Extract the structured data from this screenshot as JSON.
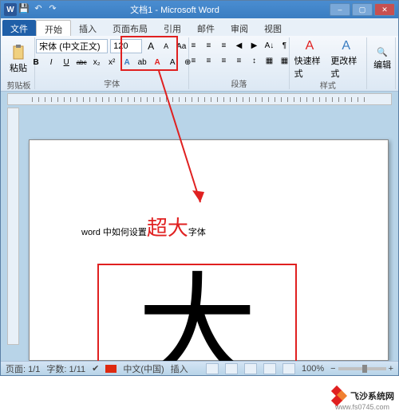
{
  "window": {
    "title": "文档1 - Microsoft Word",
    "icon_letter": "W"
  },
  "qat_icons": [
    "save",
    "undo",
    "redo",
    "repeat"
  ],
  "tabs": {
    "file": "文件",
    "items": [
      "开始",
      "插入",
      "页面布局",
      "引用",
      "邮件",
      "审阅",
      "视图"
    ],
    "active": 0
  },
  "ribbon": {
    "clipboard": {
      "label": "剪贴板",
      "paste": "粘贴"
    },
    "font": {
      "label": "字体",
      "fontname": "宋体 (中文正文)",
      "fontsize": "120",
      "grow": "A",
      "shrink": "A",
      "clear": "Aa",
      "bold": "B",
      "italic": "I",
      "underline": "U",
      "strike": "abc",
      "sub": "x₂",
      "sup": "x²"
    },
    "paragraph": {
      "label": "段落"
    },
    "styles": {
      "label": "样式",
      "quick": "快速样式",
      "change": "更改样式"
    },
    "editing": {
      "label": "编辑"
    }
  },
  "document": {
    "line1_pre": "word 中如何设置",
    "line1_red": "超大",
    "line1_post": "字体",
    "bigchar": "大"
  },
  "statusbar": {
    "page": "页面: 1/1",
    "words": "字数: 1/11",
    "lang": "中文(中国)",
    "mode": "插入",
    "zoom": "100%",
    "plus": "+",
    "minus": "−"
  },
  "watermark": {
    "brand": "飞沙系统网",
    "url": "www.fs0745.com"
  }
}
